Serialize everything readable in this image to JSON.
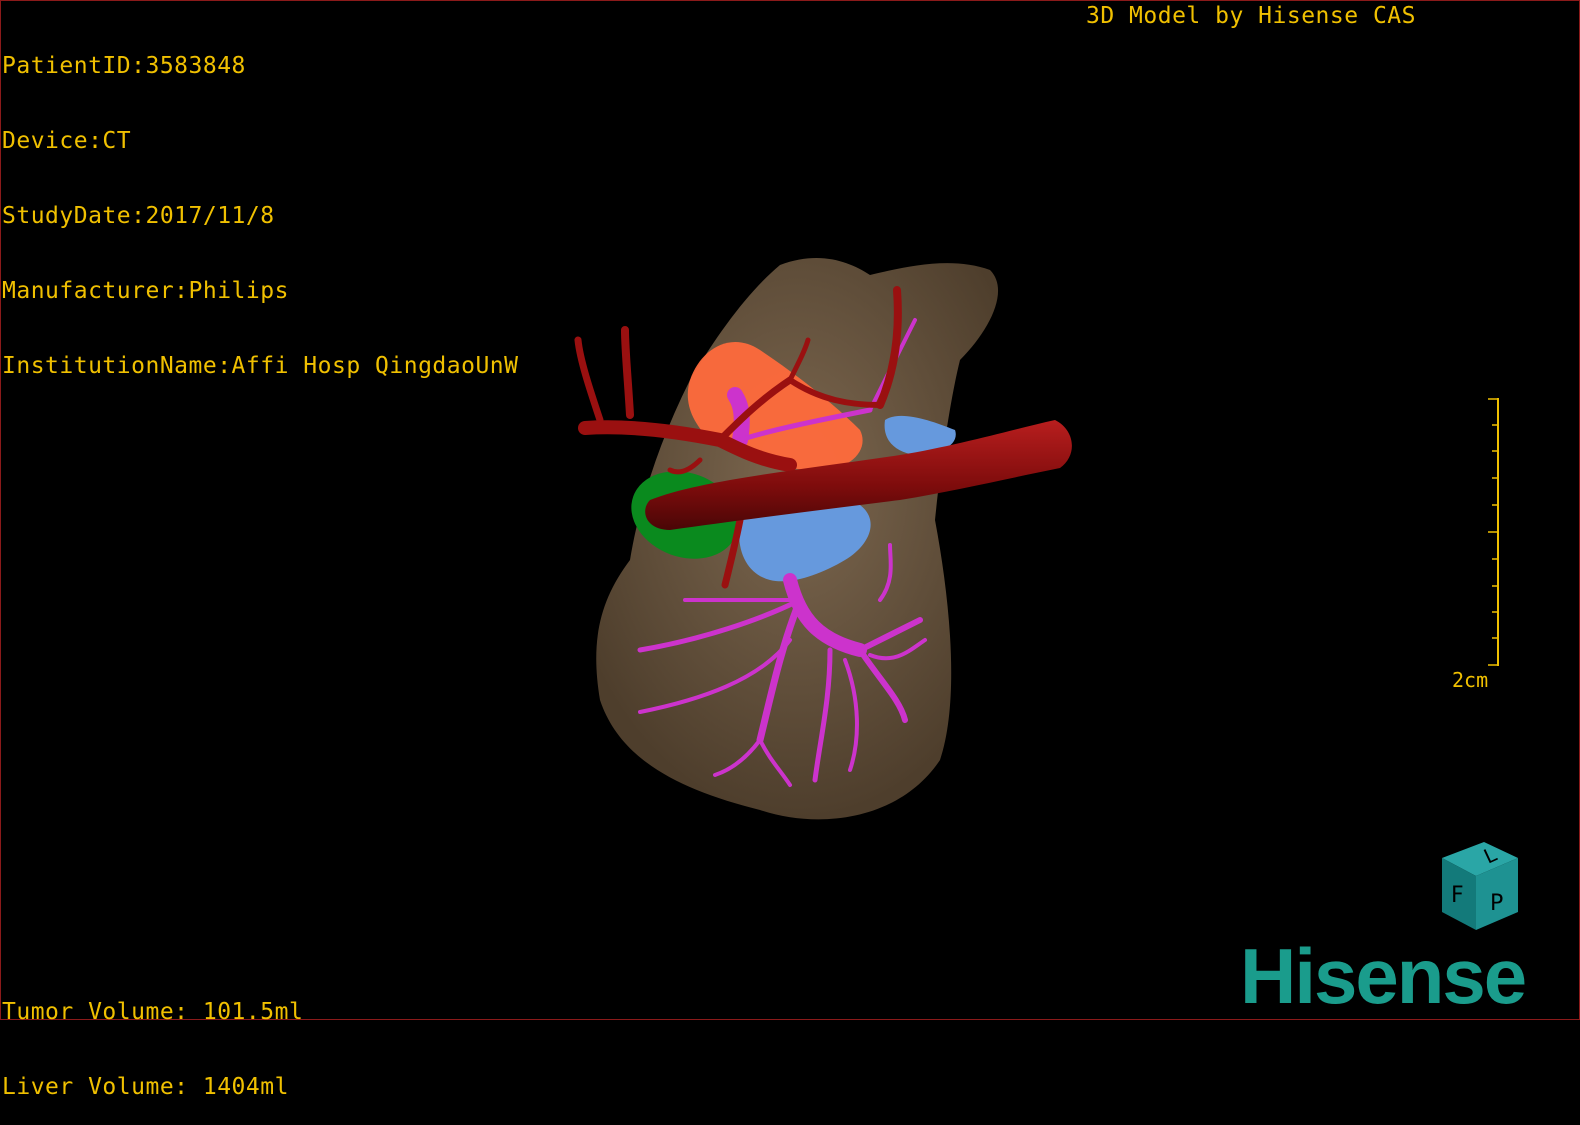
{
  "header": {
    "right_title": "3D Model by Hisense CAS"
  },
  "patient": {
    "lines": [
      "PatientID:3583848",
      "Device:CT",
      "StudyDate:2017/11/8",
      "Manufacturer:Philips",
      "InstitutionName:Affi Hosp QingdaoUnW"
    ]
  },
  "volumes": {
    "tumor": "Tumor Volume: 101.5ml",
    "liver": "Liver Volume: 1404ml"
  },
  "scale": {
    "label": "2cm"
  },
  "orientation_cube": {
    "faces": [
      "F",
      "L",
      "P"
    ]
  },
  "logo": {
    "text": "Hisense"
  },
  "colors": {
    "overlay_text": "#f0c000",
    "liver": "#6e5a42",
    "artery": "#9a1010",
    "portal_vein": "#cc33cc",
    "hepatic_vein": "#6699dd",
    "tumor": "#ff6a3c",
    "gallbladder": "#0a8a1e",
    "logo": "#1a9c8c"
  }
}
